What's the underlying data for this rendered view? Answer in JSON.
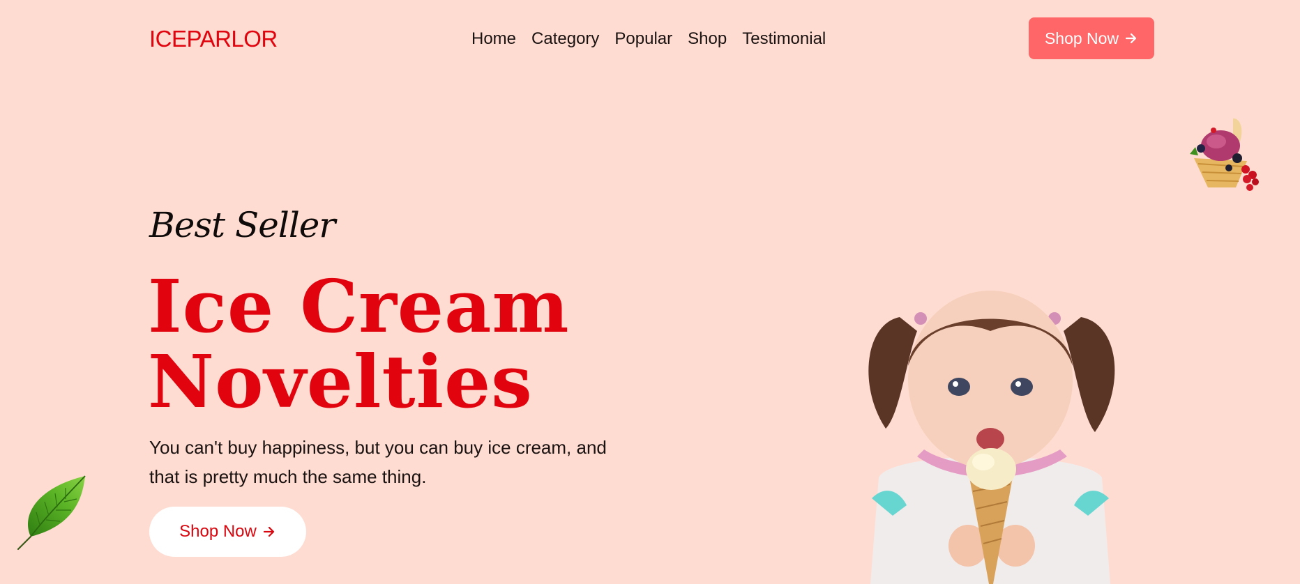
{
  "header": {
    "logo": "ICEPARLOR",
    "nav": [
      "Home",
      "Category",
      "Popular",
      "Shop",
      "Testimonial"
    ],
    "cta_label": "Shop Now",
    "cta_icon": "arrow-right-icon"
  },
  "hero": {
    "kicker": "Best Seller",
    "title_line1": "Ice Cream",
    "title_line2": "Novelties",
    "description": "You can't buy happiness, but you can buy ice cream, and that is pretty much the same thing.",
    "cta_label": "Shop Now",
    "cta_icon": "arrow-right-icon"
  },
  "colors": {
    "background": "#ffdcd1",
    "brand_red": "#e0040e",
    "cta_coral": "#fe6668",
    "white": "#ffffff"
  }
}
